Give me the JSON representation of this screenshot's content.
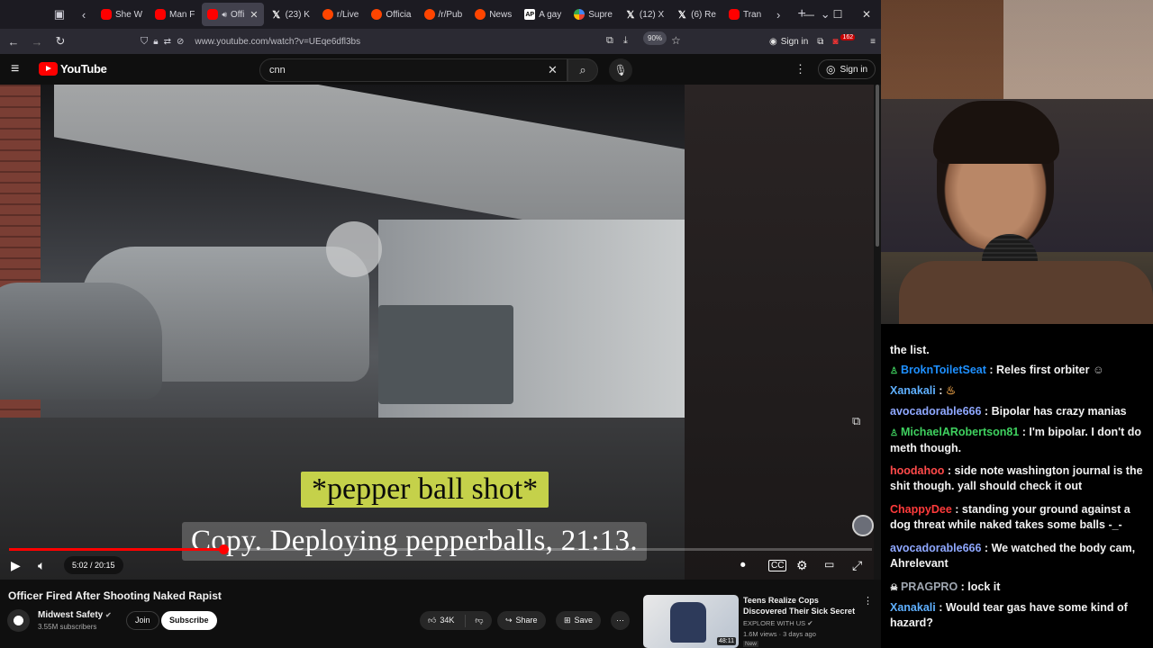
{
  "browser": {
    "tabs": [
      {
        "label": "She W",
        "icon": "youtube-favicon"
      },
      {
        "label": "Man F",
        "icon": "youtube-favicon"
      },
      {
        "label": "Offi",
        "icon": "youtube-favicon",
        "active": true
      },
      {
        "label": "(23) K",
        "icon": "x-favicon"
      },
      {
        "label": "r/Live",
        "icon": "reddit-favicon"
      },
      {
        "label": "Officia",
        "icon": "reddit-favicon"
      },
      {
        "label": "/r/Pub",
        "icon": "reddit-favicon"
      },
      {
        "label": "News",
        "icon": "reddit-favicon"
      },
      {
        "label": "A gay",
        "icon": "ap-favicon"
      },
      {
        "label": "Supre",
        "icon": "google-favicon"
      },
      {
        "label": "(12) X",
        "icon": "x-favicon"
      },
      {
        "label": "(6) Re",
        "icon": "x-favicon"
      },
      {
        "label": "Tran",
        "icon": "youtube-favicon"
      }
    ],
    "url": "www.youtube.com/watch?v=UEqe6dfl3bs",
    "zoom": "90%",
    "signin_label": "Sign in",
    "notification_count": "162"
  },
  "youtube": {
    "logo_text": "YouTube",
    "search_value": "cnn",
    "signin_label": "Sign in"
  },
  "video": {
    "subtitle_top": "*pepper ball shot*",
    "subtitle_bottom": "Copy. Deploying pepperballs, 21:13.",
    "time": "5:02 / 20:15",
    "progress": 0.248,
    "title": "Officer Fired After Shooting Naked Rapist",
    "channel": {
      "name": "Midwest Safety",
      "subscribers": "3.55M subscribers",
      "join_label": "Join",
      "subscribe_label": "Subscribe"
    },
    "actions": {
      "likes": "34K",
      "share_label": "Share",
      "save_label": "Save"
    }
  },
  "recommended": {
    "title": "Teens Realize Cops Discovered Their Sick Secret",
    "channel": "EXPLORE WITH US",
    "meta": "1.6M views · 3 days ago",
    "duration": "48:11",
    "badge": "New"
  },
  "chat": {
    "first_line": "the list.",
    "messages": [
      {
        "user": "BroknToiletSeat",
        "color": "#1e90ff",
        "text": "Reles first orbiter",
        "prefix": "icons"
      },
      {
        "user": "Xanakali",
        "color": "#5fb0ff",
        "text": ""
      },
      {
        "user": "avocadorable666",
        "color": "#8fa8ff",
        "text": "Bipolar has crazy manias"
      },
      {
        "user": "MichaelARobertson81",
        "color": "#3fd15f",
        "text": "I'm bipolar. I don't do meth though.",
        "prefix": "icons"
      },
      {
        "user": "hoodahoo",
        "color": "#ff4a4a",
        "text": "side note washington journal is the shit though. yall should check it out"
      },
      {
        "user": "ChappyDee",
        "color": "#ff3b3b",
        "text": "standing your ground against a dog threat while naked takes some balls -_-"
      },
      {
        "user": "avocadorable666",
        "color": "#8fa8ff",
        "text": "We watched the body cam, Ahrelevant"
      },
      {
        "user": "PRAGPRO",
        "color": "#9fa6b0",
        "text": "lock it",
        "prefix": "skull"
      },
      {
        "user": "Xanakali",
        "color": "#5fb0ff",
        "text": "Would tear gas have some kind of hazard?"
      }
    ]
  }
}
